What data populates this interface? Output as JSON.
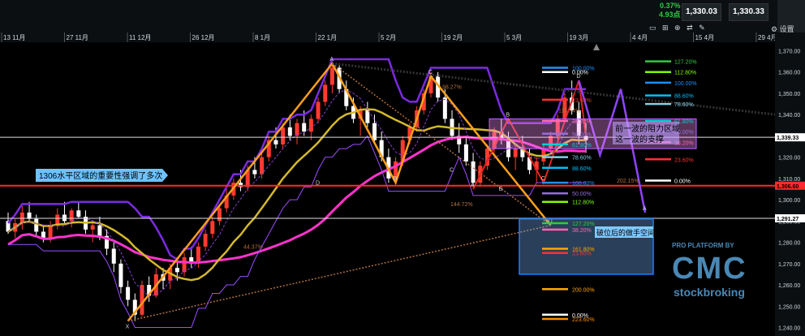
{
  "header": {
    "change_pct": "0.37%",
    "change_pts": "4.93点",
    "quote_bid": "1,330.03",
    "quote_ask": "1,330.33",
    "settings_label": "设置"
  },
  "watermark": {
    "line1": "PRO PLATFORM BY",
    "line2": "CMC",
    "line3": "stockbroking"
  },
  "chart_data": {
    "type": "candlestick",
    "title": "",
    "xlabel": "",
    "ylabel": "",
    "ylim": [
      1236,
      1374
    ],
    "x_ticks": [
      "13 11月",
      "27 11月",
      "11 12月",
      "26 12月",
      "8 1月",
      "22 1月",
      "5 2月",
      "19 2月",
      "5 3月",
      "19 3月",
      "4 4月",
      "15 4月",
      "29 4月"
    ],
    "y_ticks": [
      1240,
      1250,
      1260,
      1270,
      1280,
      1290,
      1300,
      1310,
      1320,
      1330,
      1340,
      1350,
      1360,
      1370
    ],
    "price_markers": [
      {
        "label": "1,339.33",
        "value": 1329.33,
        "color": "#e0e0e0"
      },
      {
        "label": "1,306.60",
        "value": 1306.6,
        "color": "#ff2a2a"
      },
      {
        "label": "1,291.27",
        "value": 1291.27,
        "color": "#e0e0e0"
      }
    ],
    "candles": [
      [
        1290,
        1294,
        1284,
        1285
      ],
      [
        1285,
        1291,
        1282,
        1289
      ],
      [
        1289,
        1297,
        1286,
        1294
      ],
      [
        1294,
        1299,
        1290,
        1291
      ],
      [
        1291,
        1293,
        1283,
        1285
      ],
      [
        1285,
        1288,
        1280,
        1282
      ],
      [
        1282,
        1290,
        1280,
        1288
      ],
      [
        1288,
        1296,
        1286,
        1293
      ],
      [
        1293,
        1299,
        1289,
        1290
      ],
      [
        1290,
        1296,
        1287,
        1295
      ],
      [
        1295,
        1299,
        1291,
        1292
      ],
      [
        1292,
        1295,
        1284,
        1286
      ],
      [
        1286,
        1290,
        1280,
        1288
      ],
      [
        1288,
        1292,
        1281,
        1283
      ],
      [
        1283,
        1286,
        1274,
        1277
      ],
      [
        1277,
        1280,
        1266,
        1270
      ],
      [
        1270,
        1272,
        1256,
        1259
      ],
      [
        1259,
        1262,
        1250,
        1253
      ],
      [
        1253,
        1256,
        1243,
        1246
      ],
      [
        1246,
        1262,
        1245,
        1260
      ],
      [
        1260,
        1264,
        1252,
        1255
      ],
      [
        1255,
        1268,
        1254,
        1265
      ],
      [
        1265,
        1268,
        1258,
        1262
      ],
      [
        1262,
        1270,
        1258,
        1268
      ],
      [
        1268,
        1273,
        1262,
        1266
      ],
      [
        1266,
        1275,
        1264,
        1273
      ],
      [
        1273,
        1278,
        1268,
        1270
      ],
      [
        1270,
        1280,
        1268,
        1278
      ],
      [
        1278,
        1286,
        1276,
        1284
      ],
      [
        1284,
        1292,
        1282,
        1290
      ],
      [
        1290,
        1298,
        1288,
        1296
      ],
      [
        1296,
        1305,
        1294,
        1302
      ],
      [
        1302,
        1310,
        1300,
        1308
      ],
      [
        1308,
        1314,
        1304,
        1306
      ],
      [
        1306,
        1316,
        1304,
        1314
      ],
      [
        1314,
        1320,
        1310,
        1312
      ],
      [
        1312,
        1322,
        1310,
        1320
      ],
      [
        1320,
        1330,
        1318,
        1328
      ],
      [
        1328,
        1334,
        1324,
        1326
      ],
      [
        1326,
        1336,
        1324,
        1334
      ],
      [
        1334,
        1340,
        1328,
        1330
      ],
      [
        1330,
        1338,
        1326,
        1336
      ],
      [
        1336,
        1342,
        1330,
        1332
      ],
      [
        1332,
        1340,
        1328,
        1338
      ],
      [
        1338,
        1348,
        1336,
        1346
      ],
      [
        1346,
        1356,
        1344,
        1354
      ],
      [
        1354,
        1364,
        1350,
        1362
      ],
      [
        1362,
        1364,
        1350,
        1352
      ],
      [
        1352,
        1356,
        1342,
        1344
      ],
      [
        1344,
        1348,
        1336,
        1338
      ],
      [
        1338,
        1344,
        1330,
        1342
      ],
      [
        1342,
        1346,
        1334,
        1336
      ],
      [
        1336,
        1340,
        1326,
        1328
      ],
      [
        1328,
        1332,
        1318,
        1320
      ],
      [
        1320,
        1324,
        1308,
        1310
      ],
      [
        1310,
        1320,
        1308,
        1318
      ],
      [
        1318,
        1330,
        1316,
        1328
      ],
      [
        1328,
        1336,
        1326,
        1334
      ],
      [
        1334,
        1344,
        1332,
        1342
      ],
      [
        1342,
        1352,
        1340,
        1350
      ],
      [
        1350,
        1360,
        1348,
        1358
      ],
      [
        1358,
        1360,
        1346,
        1348
      ],
      [
        1348,
        1352,
        1336,
        1338
      ],
      [
        1338,
        1342,
        1328,
        1330
      ],
      [
        1330,
        1336,
        1322,
        1326
      ],
      [
        1326,
        1330,
        1316,
        1318
      ],
      [
        1318,
        1322,
        1306,
        1308
      ],
      [
        1308,
        1318,
        1306,
        1316
      ],
      [
        1316,
        1326,
        1314,
        1324
      ],
      [
        1324,
        1334,
        1322,
        1332
      ],
      [
        1332,
        1338,
        1326,
        1328
      ],
      [
        1328,
        1332,
        1318,
        1320
      ],
      [
        1320,
        1326,
        1314,
        1324
      ],
      [
        1324,
        1330,
        1318,
        1320
      ],
      [
        1320,
        1324,
        1312,
        1314
      ],
      [
        1314,
        1320,
        1308,
        1318
      ],
      [
        1318,
        1326,
        1316,
        1324
      ],
      [
        1324,
        1332,
        1322,
        1330
      ],
      [
        1330,
        1340,
        1328,
        1338
      ],
      [
        1338,
        1350,
        1336,
        1348
      ],
      [
        1348,
        1356,
        1340,
        1342
      ],
      [
        1342,
        1346,
        1326,
        1330
      ],
      [
        1330,
        1336,
        1322,
        1328
      ]
    ],
    "fib_levels_right": [
      {
        "label": "127.20%",
        "color": "#2ecc40"
      },
      {
        "label": "112.80%",
        "color": "#7fff00"
      },
      {
        "label": "100.00%",
        "color": "#1e90ff"
      },
      {
        "label": "88.60%",
        "color": "#00bfff"
      },
      {
        "label": "78.60%",
        "color": "#87ceeb"
      },
      {
        "label": "61.80%",
        "color": "#00ced1"
      },
      {
        "label": "50.00%",
        "color": "#9370db"
      },
      {
        "label": "38.20%",
        "color": "#ff69b4"
      },
      {
        "label": "23.60%",
        "color": "#ff3030"
      },
      {
        "label": "0.00%",
        "color": "#ffffff"
      }
    ],
    "fib_levels_center": [
      {
        "label": "100.00%",
        "color": "#1e90ff"
      },
      {
        "label": "0.00%",
        "color": "#ffffff"
      },
      {
        "label": "23.60%",
        "color": "#ff3030"
      },
      {
        "label": "38.20%",
        "color": "#ff69b4"
      },
      {
        "label": "50.00%",
        "color": "#9370db"
      },
      {
        "label": "61.80%",
        "color": "#00ced1"
      },
      {
        "label": "78.60%",
        "color": "#87ceeb"
      },
      {
        "label": "88.60%",
        "color": "#00bfff"
      },
      {
        "label": "100.00%",
        "color": "#1e90ff"
      },
      {
        "label": "50.00%",
        "color": "#9370db"
      },
      {
        "label": "112.80%",
        "color": "#7fff00"
      },
      {
        "label": "127.20%",
        "color": "#2ecc40"
      },
      {
        "label": "38.20%",
        "color": "#ff69b4"
      },
      {
        "label": "161.80%",
        "color": "#ffa500"
      },
      {
        "label": "23.60%",
        "color": "#ff3030"
      },
      {
        "label": "200.00%",
        "color": "#ffa500"
      },
      {
        "label": "0.00%",
        "color": "#ffffff"
      },
      {
        "label": "223.60%",
        "color": "#ff8c00"
      }
    ],
    "misc_labels": [
      "115.74%",
      "44.37%",
      "202.15%",
      "144.72%",
      "98.27%"
    ],
    "pattern_points": [
      "X",
      "A",
      "B",
      "C",
      "D",
      "A",
      "B",
      "C",
      "D",
      "A",
      "B",
      "C",
      "D"
    ],
    "annotations": [
      {
        "text": "1306水平区域的重要性强调了多次"
      },
      {
        "text": "前一波的阻力区域\n这一波的支撑"
      },
      {
        "text": "破位后的做手空间"
      }
    ]
  }
}
